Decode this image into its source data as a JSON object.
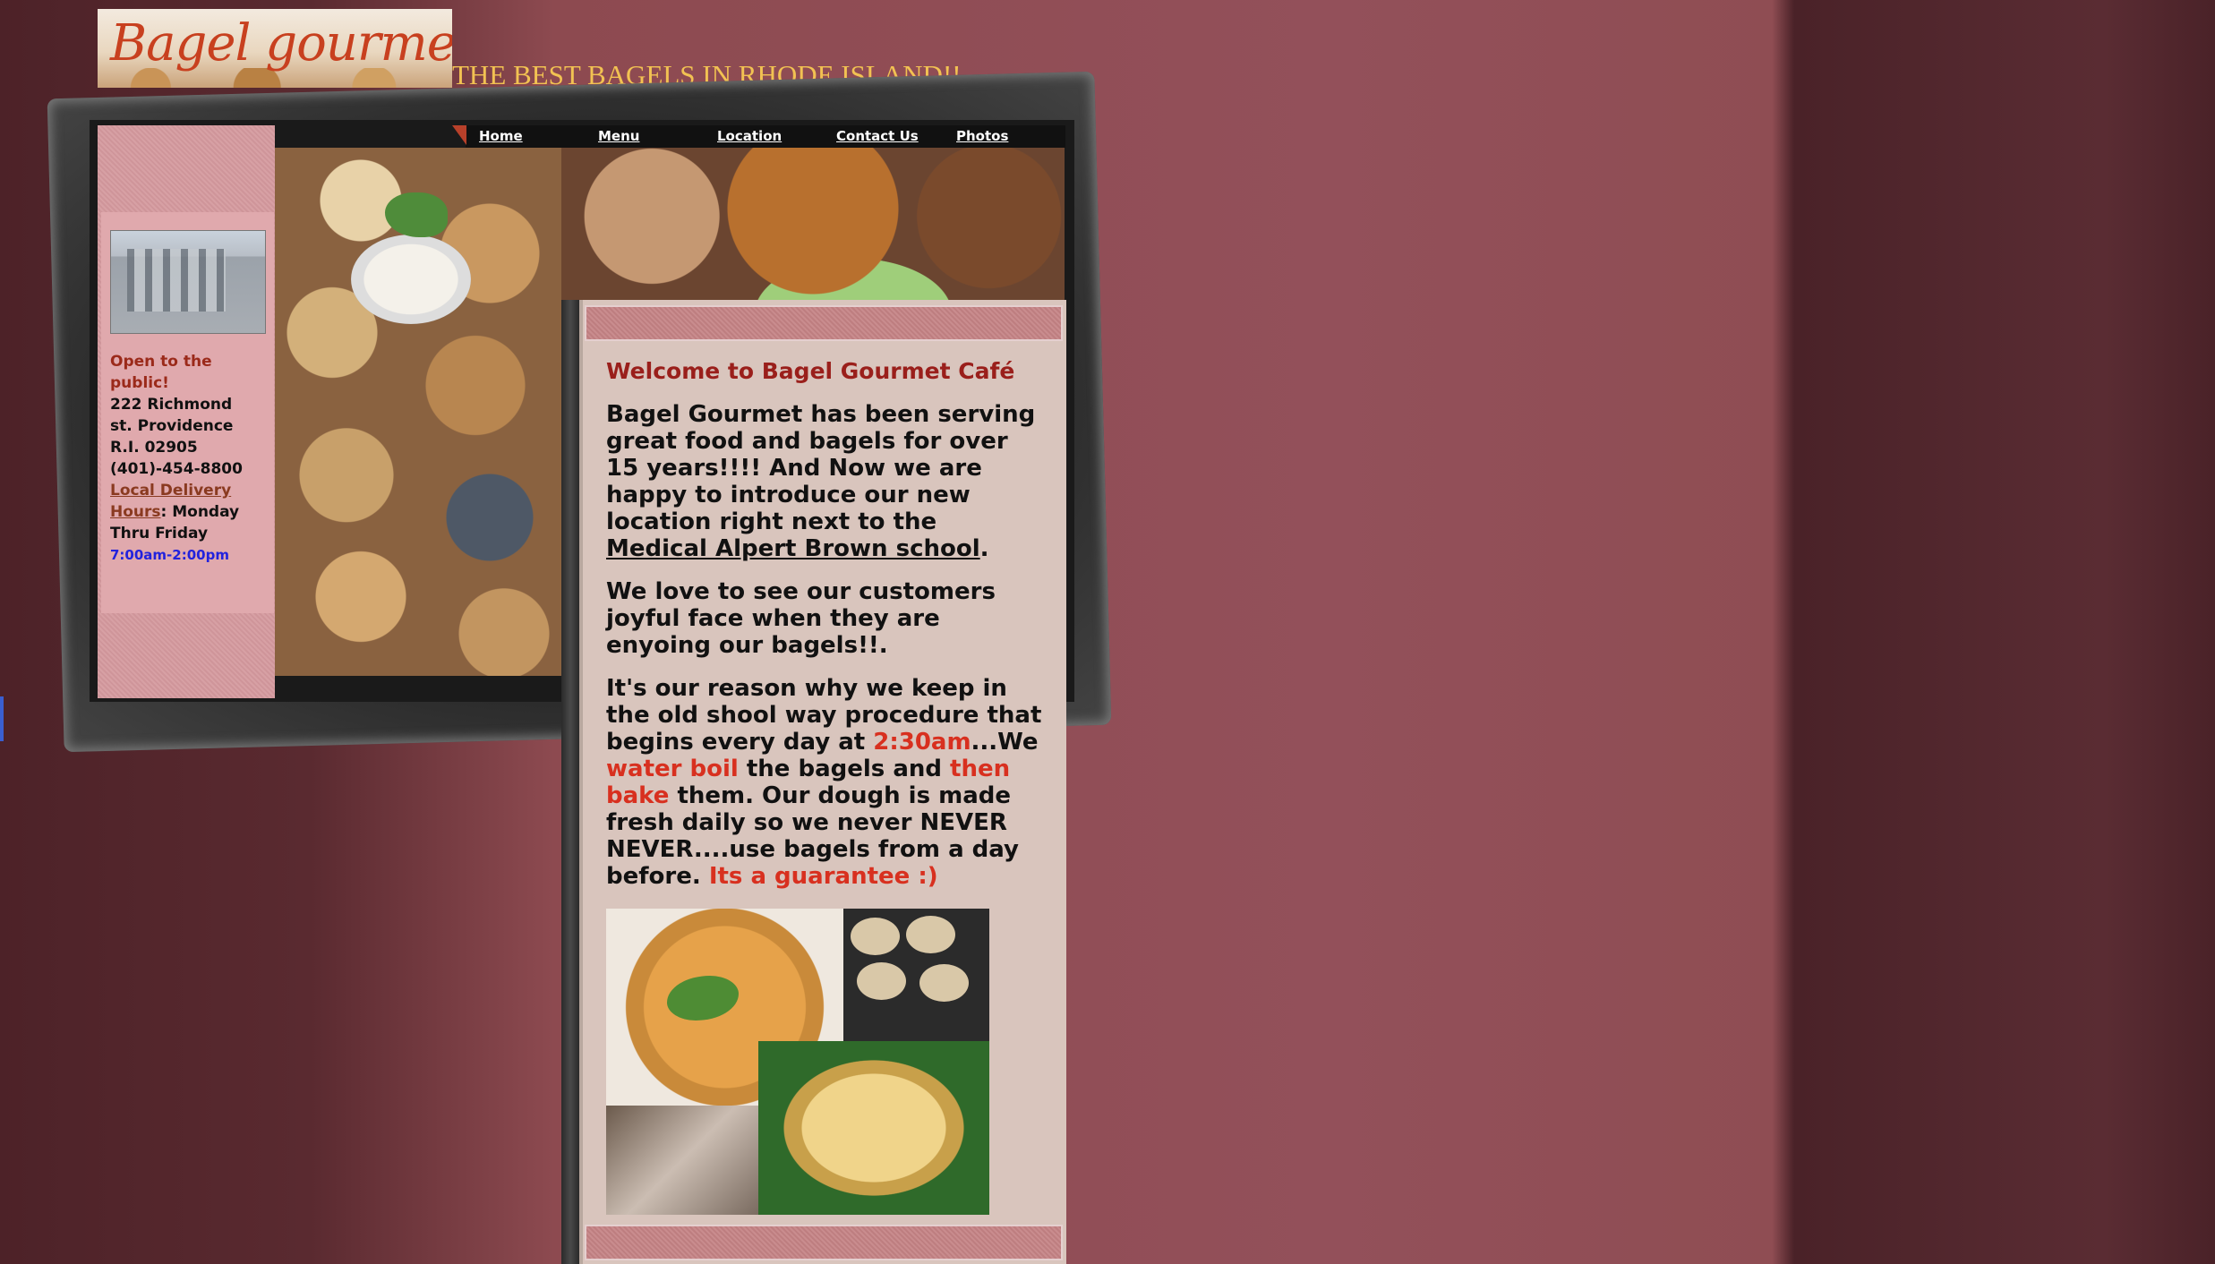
{
  "header": {
    "logo_text": "Bagel gourmet cafe",
    "tagline": "THE BEST BAGELS IN RHODE ISLAND!!"
  },
  "nav": {
    "items": [
      "Home",
      "Menu",
      "Location",
      "Contact Us",
      "Photos"
    ]
  },
  "sidebar": {
    "open_label": "Open to the public!",
    "address_line1": "222 Richmond",
    "address_line2": "st. Providence",
    "address_line3": "R.I. 02905",
    "phone": "(401)-454-8800",
    "delivery_link": "Local Delivery",
    "hours_link": "Hours",
    "hours_days_part1": ": Monday",
    "hours_days_part2": "Thru Friday",
    "hours_time": "7:00am-2:00pm"
  },
  "content": {
    "welcome_title": "Welcome to Bagel Gourmet Café",
    "p1_text": "Bagel Gourmet has been serving great food and bagels for over 15 years!!!! And Now we are happy to introduce our new location right next to the ",
    "p1_link": "Medical Alpert Brown school",
    "p1_end": ".",
    "p2_text": "We love to see our customers joyful face when they are enyoing our bagels!!.",
    "p3_a": "It's our reason why we keep in the old shool way procedure that begins every day at ",
    "p3_time": "2:30am",
    "p3_b": "...We ",
    "p3_boil": "water boil",
    "p3_c": " the bagels and ",
    "p3_bake": "then bake",
    "p3_d": " them. Our dough is made fresh daily so we never NEVER NEVER....use bagels from a day before. ",
    "p3_guarantee": "Its a guarantee :)"
  },
  "colors": {
    "tagline": "#f2c252",
    "welcome": "#9a1f1b",
    "highlight_red": "#d8301f",
    "hours_blue": "#2222dd"
  }
}
